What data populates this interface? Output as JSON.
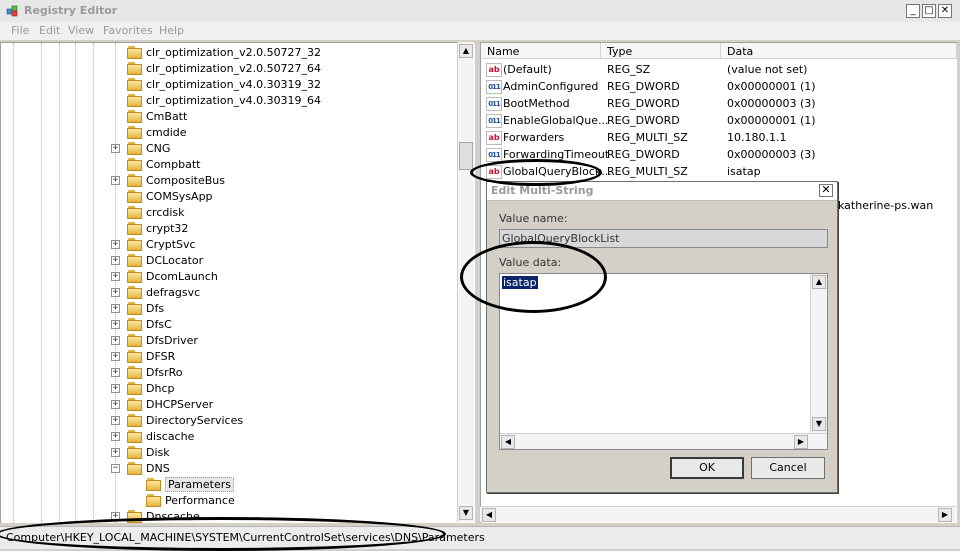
{
  "window": {
    "title": "Registry Editor",
    "minimize": "_",
    "maximize": "□",
    "close": "✕"
  },
  "menu": [
    "File",
    "Edit",
    "View",
    "Favorites",
    "Help"
  ],
  "tree": [
    {
      "label": "clr_optimization_v2.0.50727_32",
      "expander": ""
    },
    {
      "label": "clr_optimization_v2.0.50727_64",
      "expander": ""
    },
    {
      "label": "clr_optimization_v4.0.30319_32",
      "expander": ""
    },
    {
      "label": "clr_optimization_v4.0.30319_64",
      "expander": ""
    },
    {
      "label": "CmBatt",
      "expander": ""
    },
    {
      "label": "cmdide",
      "expander": ""
    },
    {
      "label": "CNG",
      "expander": "+"
    },
    {
      "label": "Compbatt",
      "expander": ""
    },
    {
      "label": "CompositeBus",
      "expander": "+"
    },
    {
      "label": "COMSysApp",
      "expander": ""
    },
    {
      "label": "crcdisk",
      "expander": ""
    },
    {
      "label": "crypt32",
      "expander": ""
    },
    {
      "label": "CryptSvc",
      "expander": "+"
    },
    {
      "label": "DCLocator",
      "expander": "+"
    },
    {
      "label": "DcomLaunch",
      "expander": "+"
    },
    {
      "label": "defragsvc",
      "expander": "+"
    },
    {
      "label": "Dfs",
      "expander": "+"
    },
    {
      "label": "DfsC",
      "expander": "+"
    },
    {
      "label": "DfsDriver",
      "expander": "+"
    },
    {
      "label": "DFSR",
      "expander": "+"
    },
    {
      "label": "DfsrRo",
      "expander": "+"
    },
    {
      "label": "Dhcp",
      "expander": "+"
    },
    {
      "label": "DHCPServer",
      "expander": "+"
    },
    {
      "label": "DirectoryServices",
      "expander": "+"
    },
    {
      "label": "discache",
      "expander": "+"
    },
    {
      "label": "Disk",
      "expander": "+"
    },
    {
      "label": "DNS",
      "expander": "−"
    },
    {
      "label": "Parameters",
      "expander": "",
      "child": true,
      "selected": true
    },
    {
      "label": "Performance",
      "expander": "",
      "child": true
    },
    {
      "label": "Dnscache",
      "expander": "+"
    }
  ],
  "columns": {
    "name": "Name",
    "type": "Type",
    "data": "Data"
  },
  "values": [
    {
      "icon": "ab",
      "name": "(Default)",
      "type": "REG_SZ",
      "data": "(value not set)"
    },
    {
      "icon": "dword",
      "name": "AdminConfigured",
      "type": "REG_DWORD",
      "data": "0x00000001 (1)"
    },
    {
      "icon": "dword",
      "name": "BootMethod",
      "type": "REG_DWORD",
      "data": "0x00000003 (3)"
    },
    {
      "icon": "dword",
      "name": "EnableGlobalQue...",
      "type": "REG_DWORD",
      "data": "0x00000001 (1)"
    },
    {
      "icon": "ab",
      "name": "Forwarders",
      "type": "REG_MULTI_SZ",
      "data": "10.180.1.1"
    },
    {
      "icon": "dword",
      "name": "ForwardingTimeout",
      "type": "REG_DWORD",
      "data": "0x00000003 (3)"
    },
    {
      "icon": "ab",
      "name": "GlobalQueryBlock...",
      "type": "REG_MULTI_SZ",
      "data": "isatap"
    }
  ],
  "partial_visible_data": "katherine-ps.wan",
  "dialog": {
    "title": "Edit Multi-String",
    "value_name_label": "Value name:",
    "value_name": "GlobalQueryBlockList",
    "value_data_label": "Value data:",
    "value_data": "isatap",
    "ok_label": "OK",
    "cancel_label": "Cancel"
  },
  "status": {
    "path": "Computer\\HKEY_LOCAL_MACHINE\\SYSTEM\\CurrentControlSet\\services\\DNS\\Parameters"
  },
  "icons": {
    "app": "registry-icon",
    "string_value": "string-value-icon",
    "dword_value": "dword-value-icon",
    "folder": "folder-icon"
  },
  "colors": {
    "selection": "#0a246a",
    "annotation": "#000000"
  }
}
